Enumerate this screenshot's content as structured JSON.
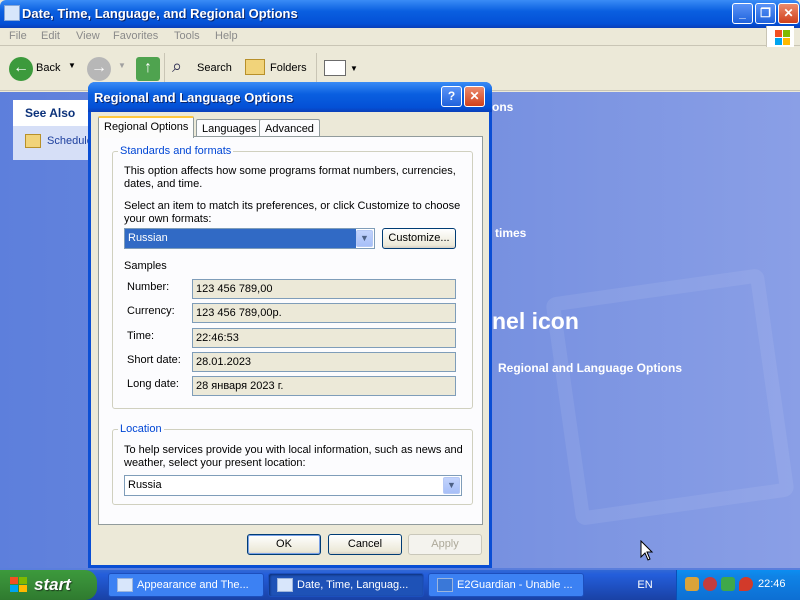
{
  "main_window": {
    "title": "Date, Time, Language, and Regional Options",
    "menu": [
      "File",
      "Edit",
      "View",
      "Favorites",
      "Tools",
      "Help"
    ],
    "toolbar": {
      "back": "Back",
      "search": "Search",
      "folders": "Folders"
    },
    "see_also": {
      "heading": "See Also",
      "link": "Schedule"
    },
    "content_fragments": {
      "f1": "ons",
      "f2": "times",
      "f3": "nel icon",
      "f4": "Regional and Language Options"
    }
  },
  "dialog": {
    "title": "Regional and Language Options",
    "help_glyph": "?",
    "close_glyph": "✕",
    "tabs": [
      "Regional Options",
      "Languages",
      "Advanced"
    ],
    "standards": {
      "legend": "Standards and formats",
      "desc_line1": "This option affects how some programs format numbers, currencies,",
      "desc_line2": "dates, and time.",
      "select_line1": "Select an item to match its preferences, or click Customize to choose",
      "select_line2": "your own formats:",
      "format_value": "Russian",
      "customize": "Customize...",
      "samples_heading": "Samples",
      "samples": [
        {
          "label": "Number:",
          "value": "123 456 789,00"
        },
        {
          "label": "Currency:",
          "value": "123 456 789,00р."
        },
        {
          "label": "Time:",
          "value": "22:46:53"
        },
        {
          "label": "Short date:",
          "value": "28.01.2023"
        },
        {
          "label": "Long date:",
          "value": "28 января 2023 г."
        }
      ]
    },
    "location": {
      "legend": "Location",
      "desc_line1": "To help services provide you with local information, such as news and",
      "desc_line2": "weather, select your present location:",
      "value": "Russia"
    },
    "buttons": {
      "ok": "OK",
      "cancel": "Cancel",
      "apply": "Apply"
    }
  },
  "taskbar": {
    "start": "start",
    "tasks": [
      "Appearance and The...",
      "Date, Time, Languag...",
      "E2Guardian - Unable ..."
    ],
    "language": "EN",
    "clock": "22:46"
  },
  "colors": {
    "xp_blue": "#0a5fe0",
    "start_green": "#388e38",
    "dialog_face": "#ece9d8"
  }
}
